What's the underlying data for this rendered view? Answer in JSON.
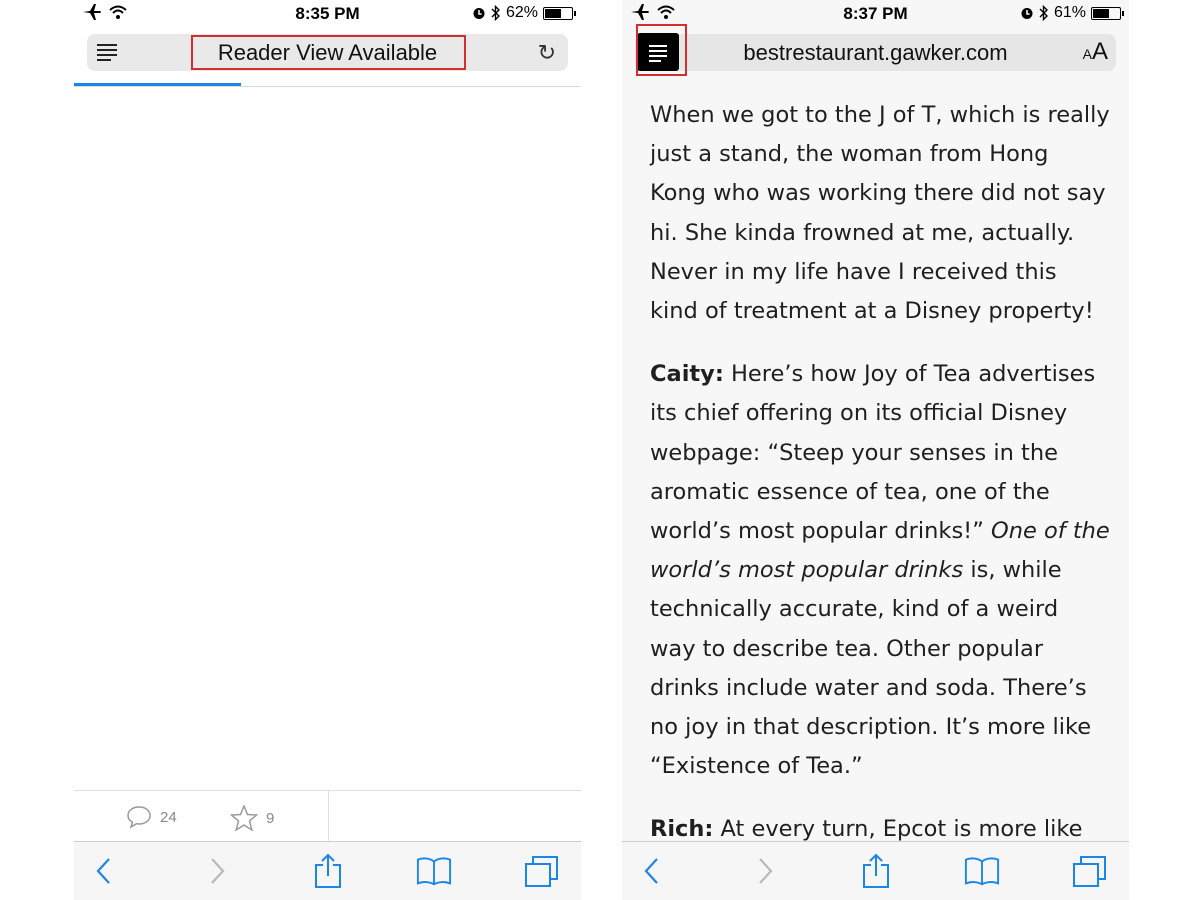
{
  "left": {
    "status": {
      "time": "8:35 PM",
      "battery": "62%",
      "battery_level": 0.62
    },
    "address_bar": {
      "text": "Reader View Available"
    },
    "page_load_progress": 0.33,
    "article_toolbar": {
      "comments_count": "24",
      "stars_count": "9"
    }
  },
  "right": {
    "status": {
      "time": "8:37 PM",
      "battery": "61%",
      "battery_level": 0.61
    },
    "address_bar": {
      "url": "bestrestaurant.gawker.com",
      "text_size_small": "A",
      "text_size_large": "A"
    },
    "article": {
      "p1": "When we got to the J of T, which is really just a stand, the woman from Hong Kong who was working there did not say hi. She kinda frowned at me, actually. Never in my life have I received this kind of treatment at a Disney property!",
      "p2_speaker": "Caity:",
      "p2_a": " Here’s how Joy of Tea advertises its chief offering on its official Disney webpage: “Steep your senses in the aromatic essence of tea, one of the world’s most popular drinks!” ",
      "p2_italic": "One of the world’s most popular drinks",
      "p2_b": " is, while technically accurate, kind of a weird way to describe tea. Other popular drinks include water and soda. There’s no joy in that description. It’s more like “Existence of Tea.”",
      "p3_speaker": "Rich:",
      "p3_a": " At every turn, Epcot is more like"
    }
  },
  "colors": {
    "accent": "#1b86e8",
    "highlight": "#d32f2f"
  }
}
